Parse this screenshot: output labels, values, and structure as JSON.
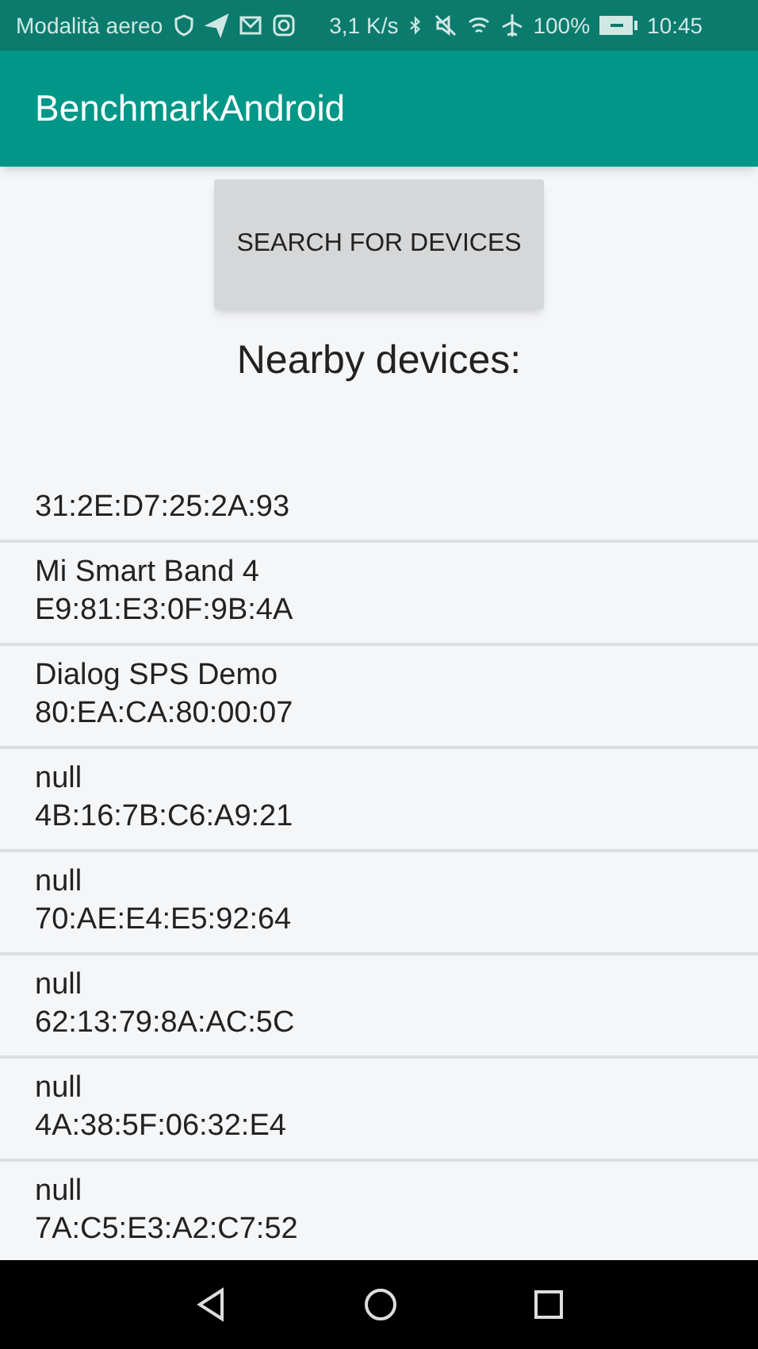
{
  "status_bar": {
    "carrier": "Modalità aereo",
    "speed": "3,1 K/s",
    "battery": "100%",
    "time": "10:45"
  },
  "app_bar": {
    "title": "BenchmarkAndroid"
  },
  "search_button": {
    "label": "SEARCH FOR DEVICES"
  },
  "heading": "Nearby devices:",
  "devices": [
    {
      "address": "31:2E:D7:25:2A:93"
    },
    {
      "name": "Mi Smart Band 4",
      "address": "E9:81:E3:0F:9B:4A"
    },
    {
      "name": "Dialog SPS Demo",
      "address": "80:EA:CA:80:00:07"
    },
    {
      "name": "null",
      "address": "4B:16:7B:C6:A9:21"
    },
    {
      "name": "null",
      "address": "70:AE:E4:E5:92:64"
    },
    {
      "name": "null",
      "address": "62:13:79:8A:AC:5C"
    },
    {
      "name": "null",
      "address": "4A:38:5F:06:32:E4"
    },
    {
      "name": "null",
      "address": "7A:C5:E3:A2:C7:52"
    }
  ]
}
